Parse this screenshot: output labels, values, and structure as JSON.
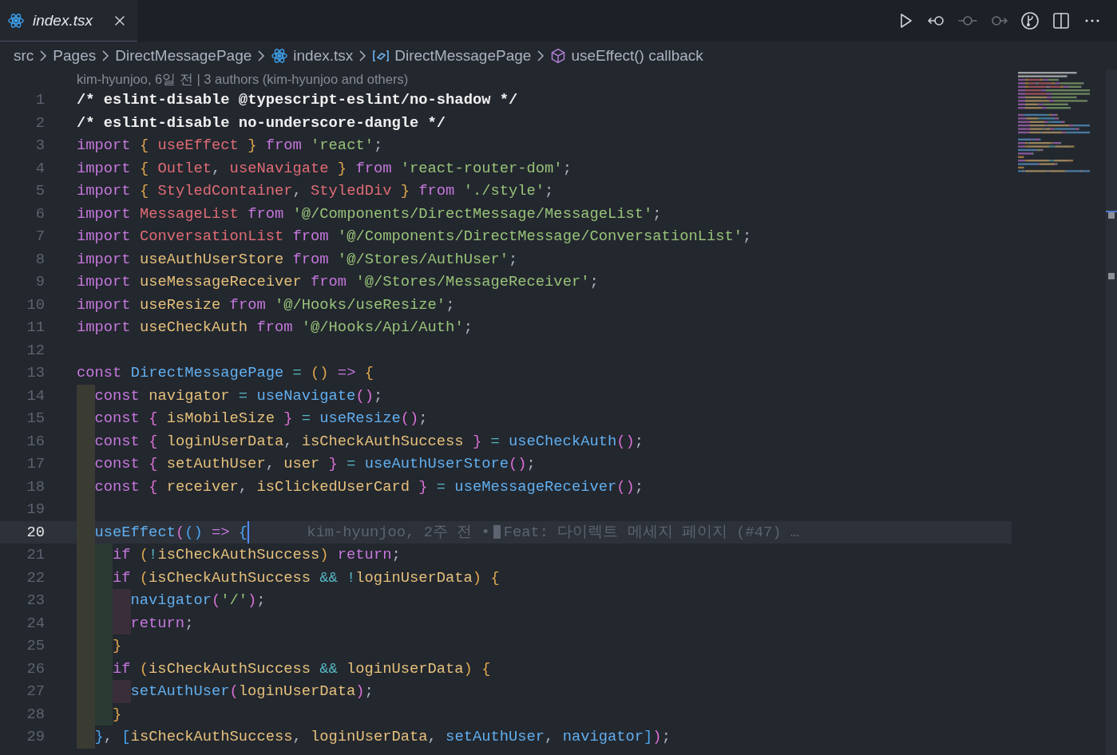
{
  "tab": {
    "label": "index.tsx",
    "preview": true,
    "selected": true
  },
  "toolbar": [
    {
      "kind": "run",
      "disabled": false
    },
    {
      "kind": "back",
      "disabled": false
    },
    {
      "kind": "commit",
      "disabled": true
    },
    {
      "kind": "forward",
      "disabled": true
    },
    {
      "kind": "graph",
      "disabled": false
    },
    {
      "kind": "split",
      "disabled": false
    },
    {
      "kind": "more",
      "disabled": false
    }
  ],
  "breadcrumb": [
    {
      "label": "src",
      "kind": "folder"
    },
    {
      "label": "Pages",
      "kind": "folder"
    },
    {
      "label": "DirectMessagePage",
      "kind": "folder"
    },
    {
      "label": "index.tsx",
      "kind": "react-file"
    },
    {
      "label": "DirectMessagePage",
      "kind": "variable"
    },
    {
      "label": "useEffect() callback",
      "kind": "method"
    }
  ],
  "codelens": "kim-hyunjoo, 6일 전 | 3 authors (kim-hyunjoo and others)",
  "lines": [
    {
      "number": "1",
      "current": false,
      "tokens": [
        {
          "kind": "cm",
          "text": "/* eslint-disable @typescript-eslint/no-shadow */"
        }
      ]
    },
    {
      "number": "2",
      "current": false,
      "tokens": [
        {
          "kind": "cm",
          "text": "/* eslint-disable no-underscore-dangle */"
        }
      ]
    },
    {
      "number": "3",
      "current": false,
      "tokens": [
        {
          "kind": "kw",
          "text": "import"
        },
        {
          "kind": "b1",
          "text": " { "
        },
        {
          "kind": "imp",
          "text": "useEffect"
        },
        {
          "kind": "b1",
          "text": " } "
        },
        {
          "kind": "kw",
          "text": "from"
        },
        {
          "kind": "str",
          "text": " 'react'"
        },
        {
          "kind": "plain",
          "text": ";"
        }
      ]
    },
    {
      "number": "4",
      "current": false,
      "tokens": [
        {
          "kind": "kw",
          "text": "import"
        },
        {
          "kind": "b1",
          "text": " { "
        },
        {
          "kind": "imp",
          "text": "Outlet"
        },
        {
          "kind": "plain",
          "text": ", "
        },
        {
          "kind": "imp",
          "text": "useNavigate"
        },
        {
          "kind": "b1",
          "text": " } "
        },
        {
          "kind": "kw",
          "text": "from"
        },
        {
          "kind": "str",
          "text": " 'react-router-dom'"
        },
        {
          "kind": "plain",
          "text": ";"
        }
      ]
    },
    {
      "number": "5",
      "current": false,
      "tokens": [
        {
          "kind": "kw",
          "text": "import"
        },
        {
          "kind": "b1",
          "text": " { "
        },
        {
          "kind": "imp",
          "text": "StyledContainer"
        },
        {
          "kind": "plain",
          "text": ", "
        },
        {
          "kind": "imp",
          "text": "StyledDiv"
        },
        {
          "kind": "b1",
          "text": " } "
        },
        {
          "kind": "kw",
          "text": "from"
        },
        {
          "kind": "str",
          "text": " './style'"
        },
        {
          "kind": "plain",
          "text": ";"
        }
      ]
    },
    {
      "number": "6",
      "current": false,
      "tokens": [
        {
          "kind": "kw",
          "text": "import"
        },
        {
          "kind": "imp",
          "text": " MessageList "
        },
        {
          "kind": "kw",
          "text": "from"
        },
        {
          "kind": "str",
          "text": " '@/Components/DirectMessage/MessageList'"
        },
        {
          "kind": "plain",
          "text": ";"
        }
      ]
    },
    {
      "number": "7",
      "current": false,
      "tokens": [
        {
          "kind": "kw",
          "text": "import"
        },
        {
          "kind": "imp",
          "text": " ConversationList "
        },
        {
          "kind": "kw",
          "text": "from"
        },
        {
          "kind": "str",
          "text": " '@/Components/DirectMessage/ConversationList'"
        },
        {
          "kind": "plain",
          "text": ";"
        }
      ]
    },
    {
      "number": "8",
      "current": false,
      "tokens": [
        {
          "kind": "kw",
          "text": "import"
        },
        {
          "kind": "var",
          "text": " useAuthUserStore "
        },
        {
          "kind": "kw",
          "text": "from"
        },
        {
          "kind": "str",
          "text": " '@/Stores/AuthUser'"
        },
        {
          "kind": "plain",
          "text": ";"
        }
      ]
    },
    {
      "number": "9",
      "current": false,
      "tokens": [
        {
          "kind": "kw",
          "text": "import"
        },
        {
          "kind": "var",
          "text": " useMessageReceiver "
        },
        {
          "kind": "kw",
          "text": "from"
        },
        {
          "kind": "str",
          "text": " '@/Stores/MessageReceiver'"
        },
        {
          "kind": "plain",
          "text": ";"
        }
      ]
    },
    {
      "number": "10",
      "current": false,
      "tokens": [
        {
          "kind": "kw",
          "text": "import"
        },
        {
          "kind": "var",
          "text": " useResize "
        },
        {
          "kind": "kw",
          "text": "from"
        },
        {
          "kind": "str",
          "text": " '@/Hooks/useResize'"
        },
        {
          "kind": "plain",
          "text": ";"
        }
      ]
    },
    {
      "number": "11",
      "current": false,
      "tokens": [
        {
          "kind": "kw",
          "text": "import"
        },
        {
          "kind": "var",
          "text": " useCheckAuth "
        },
        {
          "kind": "kw",
          "text": "from"
        },
        {
          "kind": "str",
          "text": " '@/Hooks/Api/Auth'"
        },
        {
          "kind": "plain",
          "text": ";"
        }
      ]
    },
    {
      "number": "12",
      "current": false
    },
    {
      "number": "13",
      "current": false,
      "tokens": [
        {
          "kind": "kw",
          "text": "const"
        },
        {
          "kind": "fn",
          "text": " DirectMessagePage"
        },
        {
          "kind": "op",
          "text": " = "
        },
        {
          "kind": "b1",
          "text": "()"
        },
        {
          "kind": "kw",
          "text": " => "
        },
        {
          "kind": "b1",
          "text": "{"
        }
      ]
    },
    {
      "number": "14",
      "current": false,
      "tokens": [
        {
          "kind": "kw",
          "text": "  const"
        },
        {
          "kind": "var",
          "text": " navigator"
        },
        {
          "kind": "op",
          "text": " = "
        },
        {
          "kind": "fn",
          "text": "useNavigate"
        },
        {
          "kind": "b2",
          "text": "()"
        },
        {
          "kind": "plain",
          "text": ";"
        }
      ]
    },
    {
      "number": "15",
      "current": false,
      "tokens": [
        {
          "kind": "kw",
          "text": "  const"
        },
        {
          "kind": "b2",
          "text": " { "
        },
        {
          "kind": "var",
          "text": "isMobileSize"
        },
        {
          "kind": "b2",
          "text": " } "
        },
        {
          "kind": "op",
          "text": "= "
        },
        {
          "kind": "fn",
          "text": "useResize"
        },
        {
          "kind": "b2",
          "text": "()"
        },
        {
          "kind": "plain",
          "text": ";"
        }
      ]
    },
    {
      "number": "16",
      "current": false,
      "tokens": [
        {
          "kind": "kw",
          "text": "  const"
        },
        {
          "kind": "b2",
          "text": " { "
        },
        {
          "kind": "var",
          "text": "loginUserData"
        },
        {
          "kind": "plain",
          "text": ", "
        },
        {
          "kind": "var",
          "text": "isCheckAuthSuccess"
        },
        {
          "kind": "b2",
          "text": " } "
        },
        {
          "kind": "op",
          "text": "= "
        },
        {
          "kind": "fn",
          "text": "useCheckAuth"
        },
        {
          "kind": "b2",
          "text": "()"
        },
        {
          "kind": "plain",
          "text": ";"
        }
      ]
    },
    {
      "number": "17",
      "current": false,
      "tokens": [
        {
          "kind": "kw",
          "text": "  const"
        },
        {
          "kind": "b2",
          "text": " { "
        },
        {
          "kind": "var",
          "text": "setAuthUser"
        },
        {
          "kind": "plain",
          "text": ", "
        },
        {
          "kind": "var",
          "text": "user"
        },
        {
          "kind": "b2",
          "text": " } "
        },
        {
          "kind": "op",
          "text": "= "
        },
        {
          "kind": "fn",
          "text": "useAuthUserStore"
        },
        {
          "kind": "b2",
          "text": "()"
        },
        {
          "kind": "plain",
          "text": ";"
        }
      ]
    },
    {
      "number": "18",
      "current": false,
      "tokens": [
        {
          "kind": "kw",
          "text": "  const"
        },
        {
          "kind": "b2",
          "text": " { "
        },
        {
          "kind": "var",
          "text": "receiver"
        },
        {
          "kind": "plain",
          "text": ", "
        },
        {
          "kind": "var",
          "text": "isClickedUserCard"
        },
        {
          "kind": "b2",
          "text": " } "
        },
        {
          "kind": "op",
          "text": "= "
        },
        {
          "kind": "fn",
          "text": "useMessageReceiver"
        },
        {
          "kind": "b2",
          "text": "()"
        },
        {
          "kind": "plain",
          "text": ";"
        }
      ]
    },
    {
      "number": "19",
      "current": false
    },
    {
      "number": "20",
      "current": true,
      "blame": "kim-hyunjoo, 2주 전 • Feat: 다이렉트 메세지 페이지 (#47) …",
      "tokens": [
        {
          "kind": "fn",
          "text": "  useEffect"
        },
        {
          "kind": "b2",
          "text": "("
        },
        {
          "kind": "b3",
          "text": "()"
        },
        {
          "kind": "kw",
          "text": " => "
        },
        {
          "kind": "b3",
          "text": "{"
        }
      ]
    },
    {
      "number": "21",
      "current": false,
      "tokens": [
        {
          "kind": "kw",
          "text": "    if"
        },
        {
          "kind": "b1",
          "text": " ("
        },
        {
          "kind": "op",
          "text": "!"
        },
        {
          "kind": "var",
          "text": "isCheckAuthSuccess"
        },
        {
          "kind": "b1",
          "text": ") "
        },
        {
          "kind": "kw",
          "text": "return"
        },
        {
          "kind": "plain",
          "text": ";"
        }
      ]
    },
    {
      "number": "22",
      "current": false,
      "tokens": [
        {
          "kind": "kw",
          "text": "    if"
        },
        {
          "kind": "b1",
          "text": " ("
        },
        {
          "kind": "var",
          "text": "isCheckAuthSuccess"
        },
        {
          "kind": "op",
          "text": " && !"
        },
        {
          "kind": "var",
          "text": "loginUserData"
        },
        {
          "kind": "b1",
          "text": ") {"
        }
      ]
    },
    {
      "number": "23",
      "current": false,
      "tokens": [
        {
          "kind": "fn",
          "text": "      navigator"
        },
        {
          "kind": "b2",
          "text": "("
        },
        {
          "kind": "str",
          "text": "'/'"
        },
        {
          "kind": "b2",
          "text": ")"
        },
        {
          "kind": "plain",
          "text": ";"
        }
      ]
    },
    {
      "number": "24",
      "current": false,
      "tokens": [
        {
          "kind": "kw",
          "text": "      return"
        },
        {
          "kind": "plain",
          "text": ";"
        }
      ]
    },
    {
      "number": "25",
      "current": false,
      "tokens": [
        {
          "kind": "b1",
          "text": "    }"
        }
      ]
    },
    {
      "number": "26",
      "current": false,
      "tokens": [
        {
          "kind": "kw",
          "text": "    if"
        },
        {
          "kind": "b1",
          "text": " ("
        },
        {
          "kind": "var",
          "text": "isCheckAuthSuccess"
        },
        {
          "kind": "op",
          "text": " && "
        },
        {
          "kind": "var",
          "text": "loginUserData"
        },
        {
          "kind": "b1",
          "text": ") {"
        }
      ]
    },
    {
      "number": "27",
      "current": false,
      "tokens": [
        {
          "kind": "fn",
          "text": "      setAuthUser"
        },
        {
          "kind": "b2",
          "text": "("
        },
        {
          "kind": "var",
          "text": "loginUserData"
        },
        {
          "kind": "b2",
          "text": ")"
        },
        {
          "kind": "plain",
          "text": ";"
        }
      ]
    },
    {
      "number": "28",
      "current": false,
      "tokens": [
        {
          "kind": "b1",
          "text": "    }"
        }
      ]
    },
    {
      "number": "29",
      "current": false,
      "tokens": [
        {
          "kind": "b3",
          "text": "  }"
        },
        {
          "kind": "plain",
          "text": ", "
        },
        {
          "kind": "b3",
          "text": "["
        },
        {
          "kind": "var",
          "text": "isCheckAuthSuccess"
        },
        {
          "kind": "plain",
          "text": ", "
        },
        {
          "kind": "var",
          "text": "loginUserData"
        },
        {
          "kind": "plain",
          "text": ", "
        },
        {
          "kind": "fn",
          "text": "setAuthUser"
        },
        {
          "kind": "plain",
          "text": ", "
        },
        {
          "kind": "fn",
          "text": "navigator"
        },
        {
          "kind": "b3",
          "text": "]"
        },
        {
          "kind": "b2",
          "text": ")"
        },
        {
          "kind": "plain",
          "text": ";"
        }
      ]
    }
  ]
}
